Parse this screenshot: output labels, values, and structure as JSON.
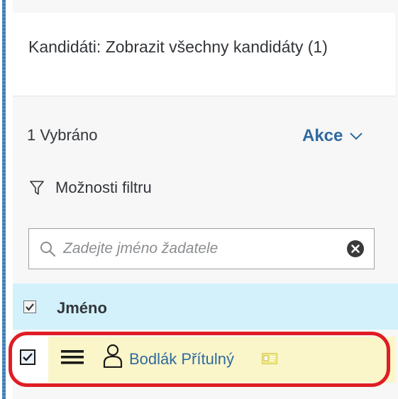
{
  "header": {
    "title": "Kandidáti: Zobrazit všechny kandidáty (1)"
  },
  "toolbar": {
    "selected_count": "1 Vybráno",
    "actions_label": "Akce",
    "actions_icon": "chevron-down-icon"
  },
  "filter": {
    "label": "Možnosti filtru",
    "icon": "filter-icon"
  },
  "search": {
    "placeholder": "Zadejte jméno žadatele",
    "value": ""
  },
  "table": {
    "columns": [
      {
        "label": "Jméno",
        "checked": true
      }
    ],
    "rows": [
      {
        "name": "Bodlák Přítulný",
        "checked": true
      }
    ]
  },
  "colors": {
    "accent": "#2f6a9f",
    "header_row_bg": "#d2f1fb",
    "selected_row_bg": "#faf6c9",
    "highlight_outline": "#e01c24"
  }
}
